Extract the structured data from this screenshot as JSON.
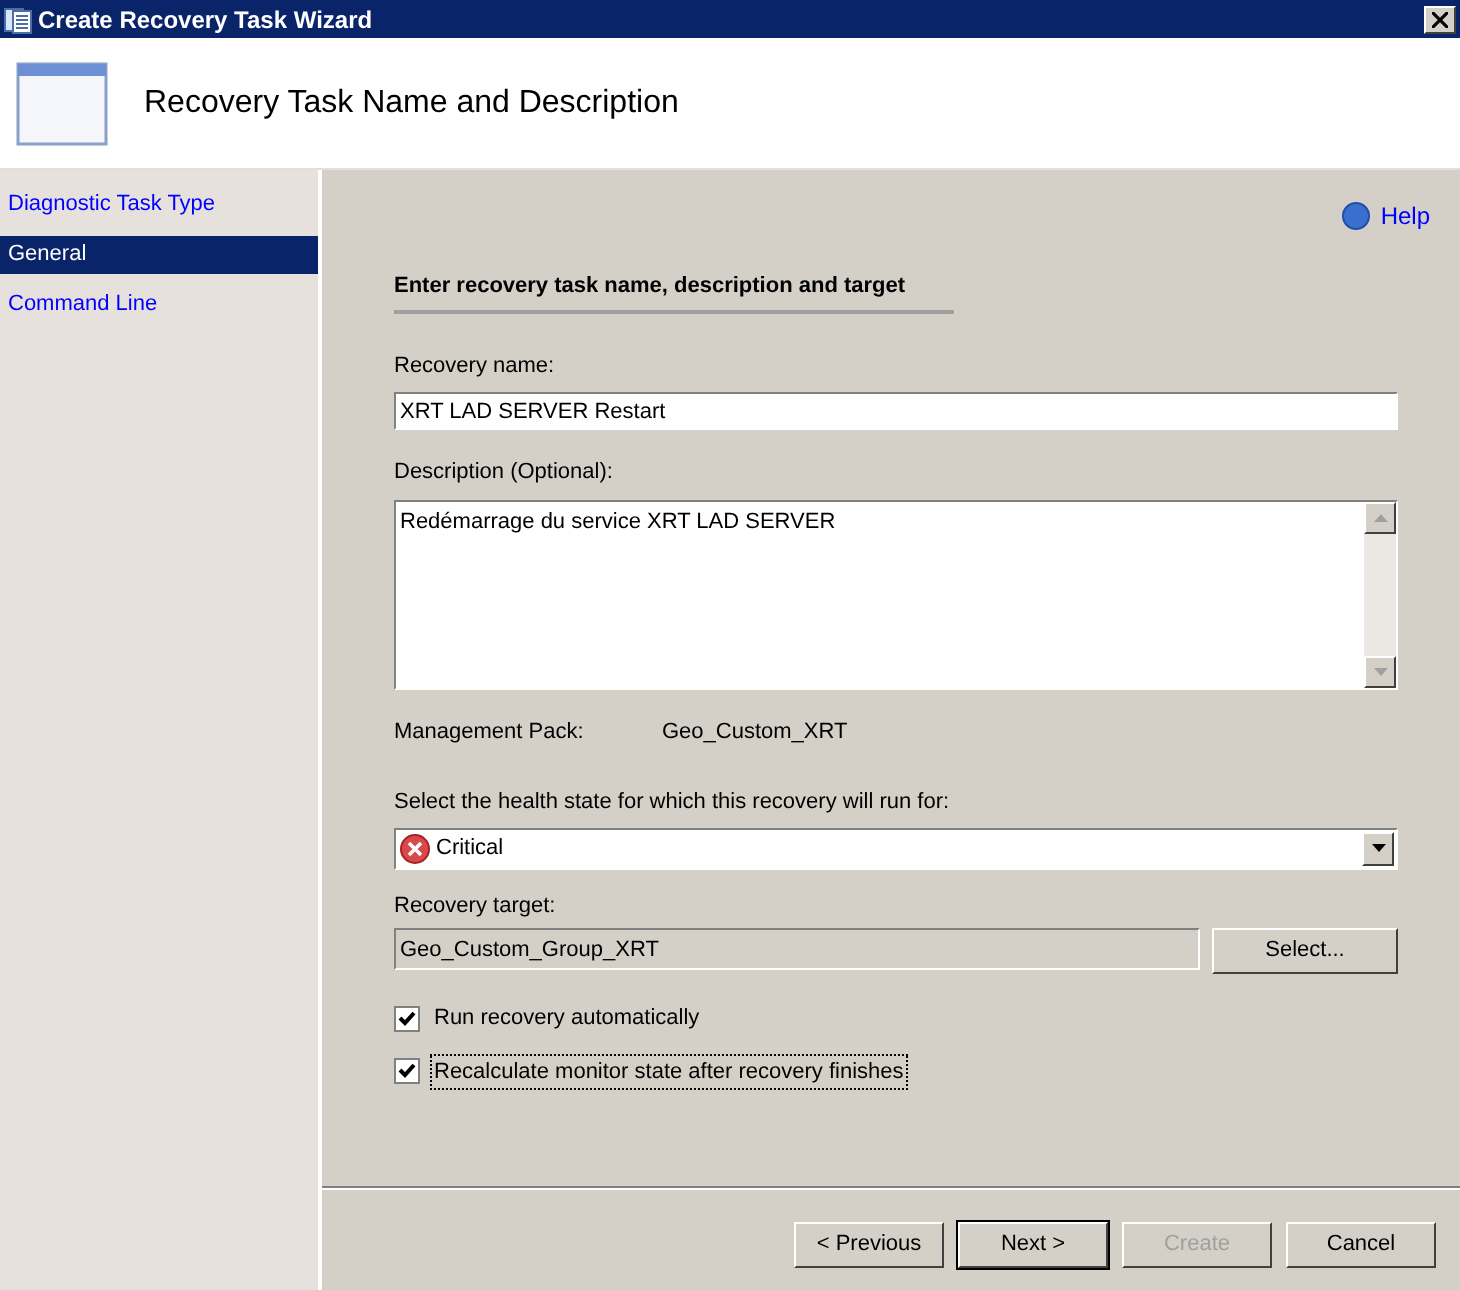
{
  "window": {
    "title": "Create Recovery Task Wizard"
  },
  "header": {
    "title": "Recovery Task Name and Description"
  },
  "sidebar": {
    "items": [
      {
        "label": "Diagnostic Task Type",
        "selected": false
      },
      {
        "label": "General",
        "selected": true
      },
      {
        "label": "Command Line",
        "selected": false
      }
    ]
  },
  "help_link": "Help",
  "section_heading": "Enter recovery task name, description and target",
  "recovery_name": {
    "label": "Recovery name:",
    "value": "XRT LAD SERVER Restart"
  },
  "description": {
    "label": "Description (Optional):",
    "value": "Redémarrage du service XRT LAD SERVER"
  },
  "management_pack": {
    "label": "Management Pack:",
    "value": "Geo_Custom_XRT"
  },
  "health_state": {
    "label": "Select the health state for which this recovery will run for:",
    "value": "Critical"
  },
  "recovery_target": {
    "label": "Recovery target:",
    "value": "Geo_Custom_Group_XRT",
    "button": "Select..."
  },
  "options": [
    {
      "label": "Run recovery automatically",
      "checked": true,
      "focused": false
    },
    {
      "label": "Recalculate monitor state after recovery finishes",
      "checked": true,
      "focused": true
    }
  ],
  "buttons": [
    {
      "label": "< Previous",
      "disabled": false,
      "default": false
    },
    {
      "label": "Next >",
      "disabled": false,
      "default": true
    },
    {
      "label": "Create",
      "disabled": true,
      "default": false
    },
    {
      "label": "Cancel",
      "disabled": false,
      "default": false
    }
  ]
}
